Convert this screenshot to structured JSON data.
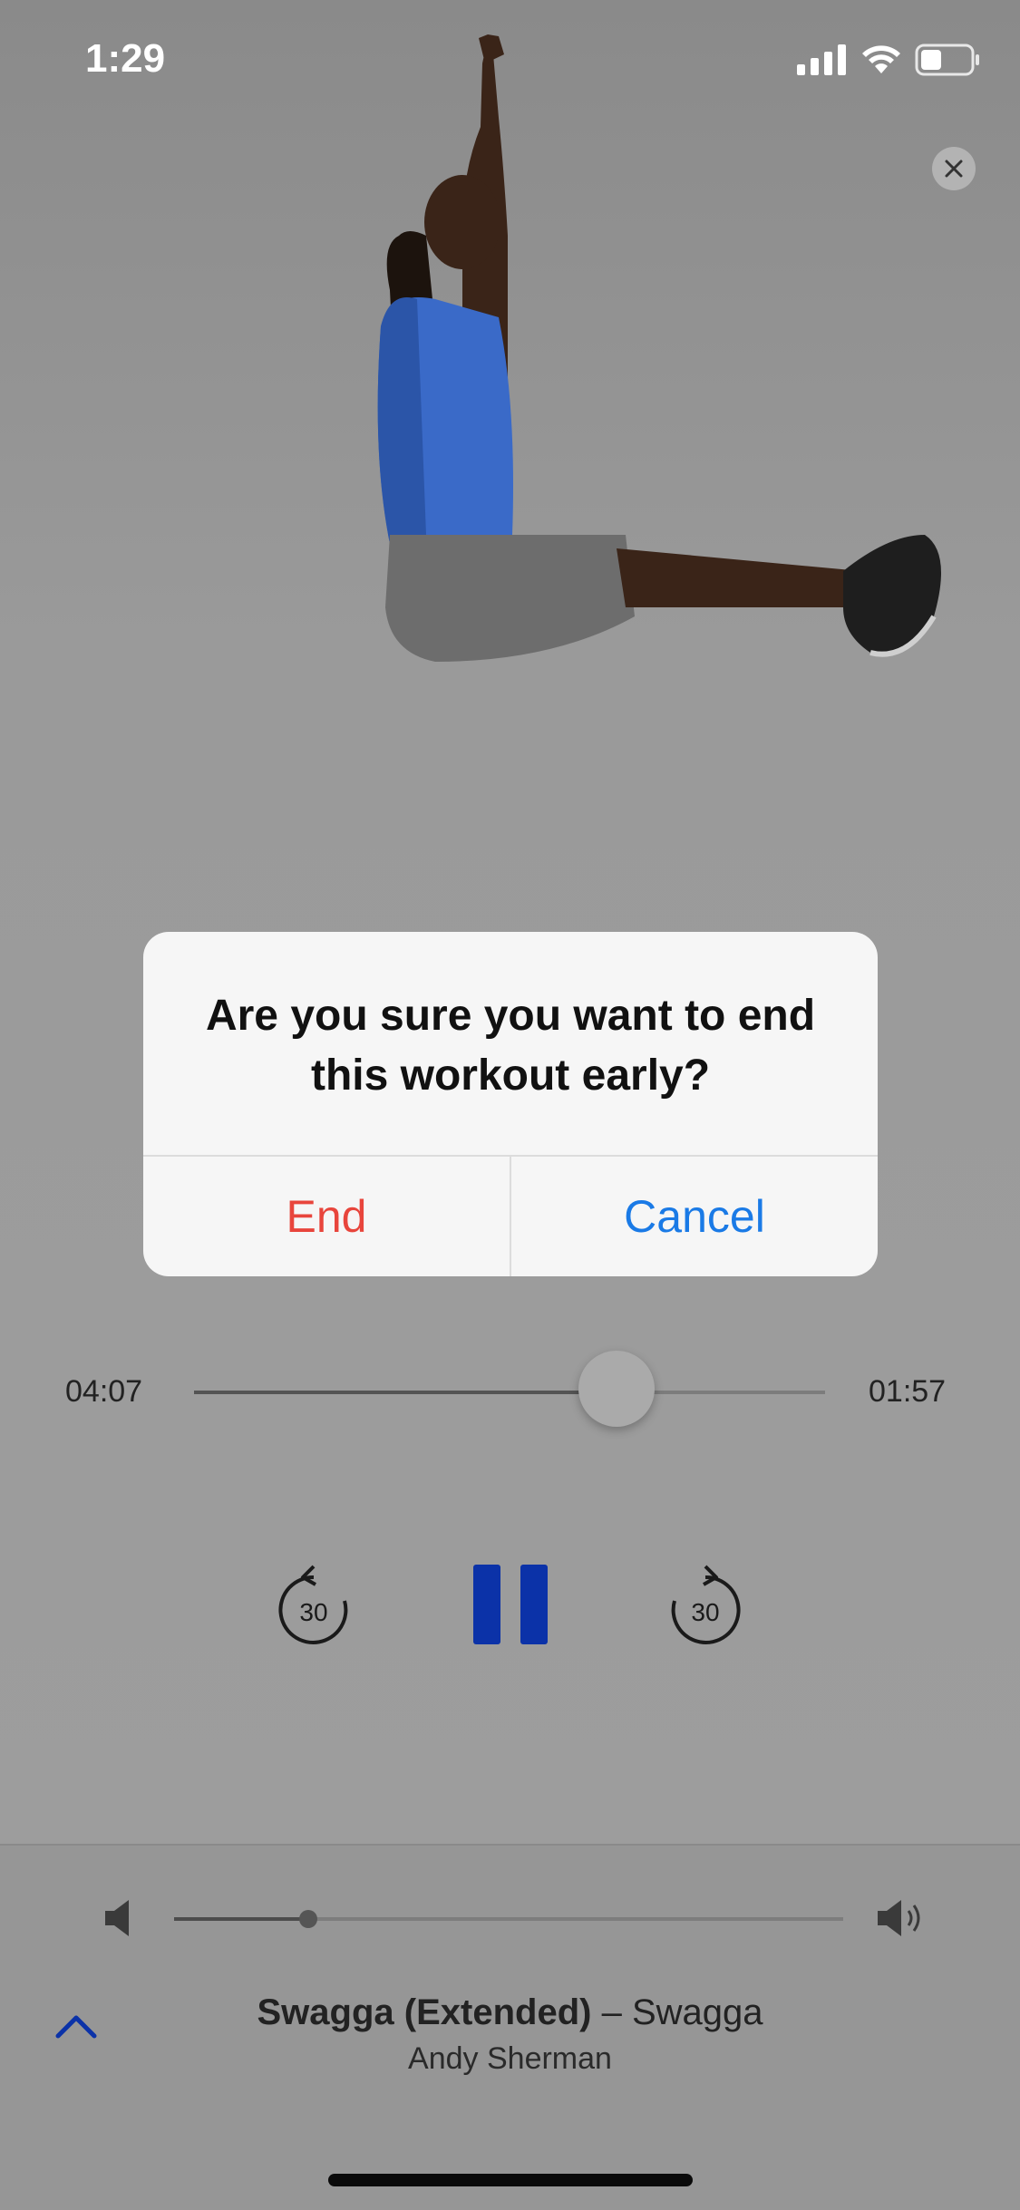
{
  "status_bar": {
    "time": "1:29",
    "icons": [
      "signal-icon",
      "wifi-icon",
      "battery-icon"
    ]
  },
  "close_icon": "close-icon",
  "dialog": {
    "message": "Are you sure you want to end this workout early?",
    "end_label": "End",
    "cancel_label": "Cancel",
    "end_color": "#e8453c",
    "cancel_color": "#1a7ae6"
  },
  "progress": {
    "elapsed": "04:07",
    "remaining": "01:57",
    "fraction": 0.67
  },
  "controls": {
    "rewind_label": "30",
    "forward_label": "30",
    "pause_icon": "pause-icon",
    "accent_color": "#0b32a8"
  },
  "volume": {
    "level": 0.2
  },
  "now_playing": {
    "title": "Swagga (Extended)",
    "separator": " – ",
    "album": "Swagga",
    "artist": "Andy Sherman"
  }
}
